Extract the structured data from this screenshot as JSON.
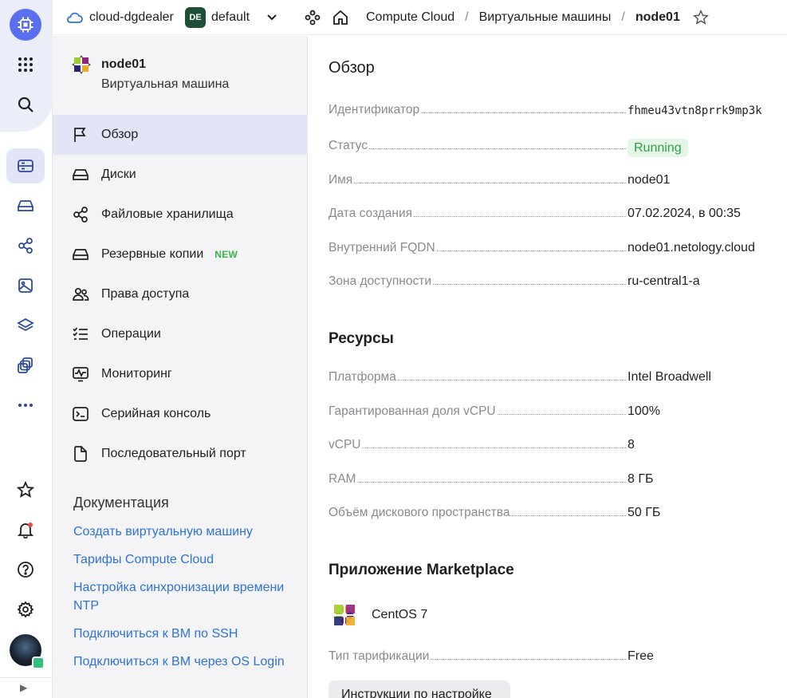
{
  "rail": {
    "icons": [
      "compute-cloud-logo-icon",
      "apps-grid-icon",
      "search-icon",
      "vm-service-icon",
      "disk-service-icon",
      "share-icon",
      "image-icon",
      "layers-icon",
      "stack-icon",
      "more-icon",
      "star-icon",
      "bell-icon",
      "help-icon",
      "gear-icon",
      "avatar",
      "expand-icon"
    ],
    "accent_color": "#5a6ef0",
    "expand_glyph": "▶"
  },
  "header": {
    "cloud_name": "cloud-dgdealer",
    "folder_badge": "DE",
    "folder_name": "default",
    "breadcrumbs": [
      "Compute Cloud",
      "Виртуальные машины",
      "node01"
    ],
    "separator": "/"
  },
  "resource": {
    "title": "node01",
    "subtitle": "Виртуальная машина"
  },
  "nav": {
    "items": [
      {
        "label": "Обзор",
        "icon": "flag-icon"
      },
      {
        "label": "Диски",
        "icon": "disk-icon"
      },
      {
        "label": "Файловые хранилища",
        "icon": "share-icon"
      },
      {
        "label": "Резервные копии",
        "icon": "backup-icon",
        "badge": "NEW"
      },
      {
        "label": "Права доступа",
        "icon": "users-icon"
      },
      {
        "label": "Операции",
        "icon": "list-check-icon"
      },
      {
        "label": "Мониторинг",
        "icon": "monitoring-icon"
      },
      {
        "label": "Серийная консоль",
        "icon": "terminal-icon"
      },
      {
        "label": "Последовательный порт",
        "icon": "file-icon"
      }
    ]
  },
  "docs": {
    "title": "Документация",
    "links": [
      "Создать виртуальную машину",
      "Тарифы Compute Cloud",
      "Настройка синхронизации времени NTP",
      "Подключиться к ВМ по SSH",
      "Подключиться к ВМ через OS Login"
    ]
  },
  "overview": {
    "title": "Обзор",
    "rows": [
      {
        "label": "Идентификатор",
        "value": "fhmeu43vtn8prrk9mp3k"
      },
      {
        "label": "Статус",
        "value": "Running"
      },
      {
        "label": "Имя",
        "value": "node01"
      },
      {
        "label": "Дата создания",
        "value": "07.02.2024, в 00:35"
      },
      {
        "label": "Внутренний FQDN",
        "value": "node01.netology.cloud"
      },
      {
        "label": "Зона доступности",
        "value": "ru-central1-a"
      }
    ]
  },
  "resources": {
    "title": "Ресурсы",
    "rows": [
      {
        "label": "Платформа",
        "value": "Intel Broadwell"
      },
      {
        "label": "Гарантированная доля vCPU",
        "value": "100%"
      },
      {
        "label": "vCPU",
        "value": "8"
      },
      {
        "label": "RAM",
        "value": "8 ГБ"
      },
      {
        "label": "Объём дискового пространства",
        "value": "50 ГБ"
      }
    ]
  },
  "marketplace": {
    "title": "Приложение Marketplace",
    "app_name": "CentOS 7",
    "billing_label": "Тип тарификации",
    "billing_value": "Free",
    "button_label": "Инструкции по настройке"
  },
  "colors": {
    "status_running_bg": "#e4f6e7",
    "status_running_fg": "#2e9f47",
    "link": "#2e72d8",
    "new_badge": "#3bb54a"
  }
}
